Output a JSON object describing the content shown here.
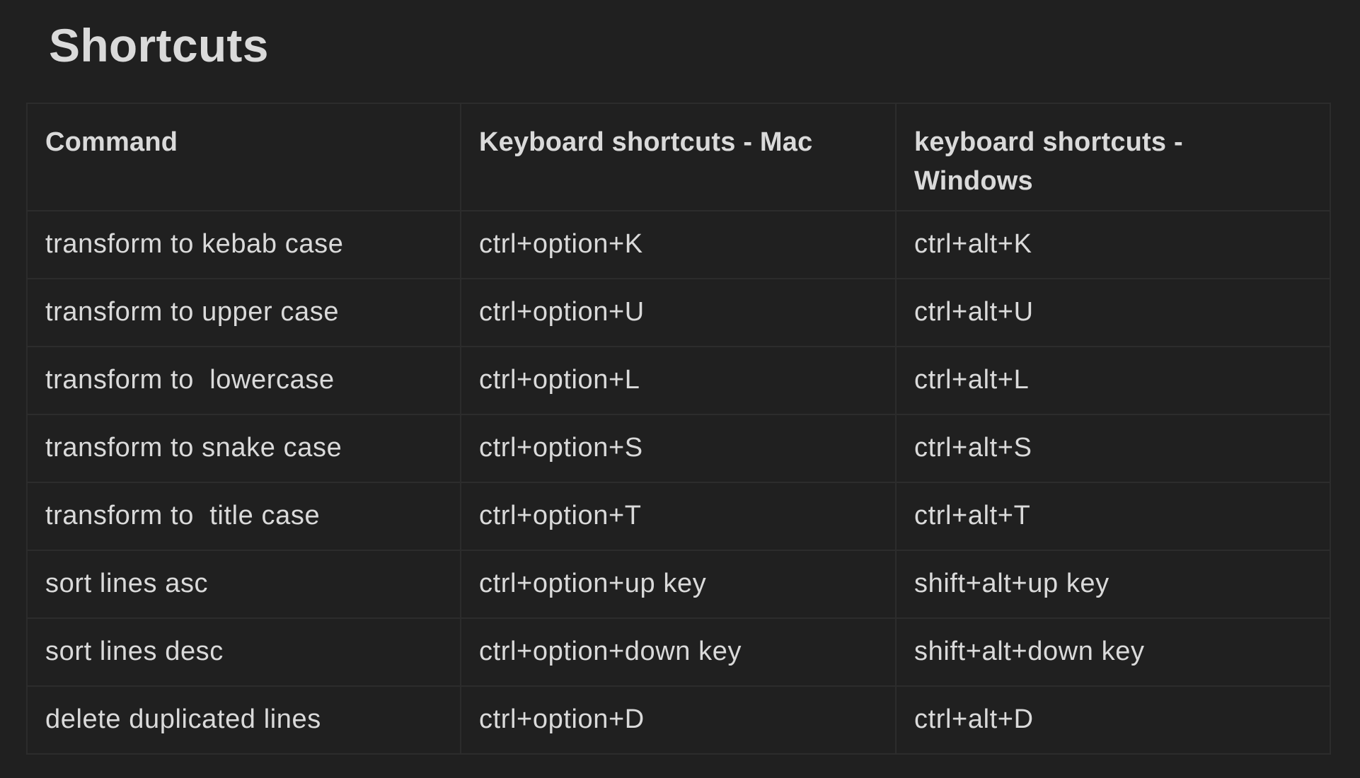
{
  "page": {
    "title": "Shortcuts"
  },
  "table": {
    "headers": [
      "Command",
      "Keyboard shortcuts - Mac",
      "keyboard shortcuts - Windows"
    ],
    "rows": [
      {
        "command": "transform to kebab case",
        "mac": "ctrl+option+K",
        "windows": "ctrl+alt+K"
      },
      {
        "command": "transform to upper case",
        "mac": "ctrl+option+U",
        "windows": "ctrl+alt+U"
      },
      {
        "command": "transform to  lowercase",
        "mac": "ctrl+option+L",
        "windows": "ctrl+alt+L"
      },
      {
        "command": "transform to snake case",
        "mac": "ctrl+option+S",
        "windows": "ctrl+alt+S"
      },
      {
        "command": "transform to  title case",
        "mac": "ctrl+option+T",
        "windows": "ctrl+alt+T"
      },
      {
        "command": "sort lines asc",
        "mac": "ctrl+option+up key",
        "windows": "shift+alt+up key"
      },
      {
        "command": "sort lines desc",
        "mac": "ctrl+option+down key",
        "windows": "shift+alt+down key"
      },
      {
        "command": "delete duplicated lines",
        "mac": "ctrl+option+D",
        "windows": "ctrl+alt+D"
      }
    ]
  },
  "colors": {
    "background": "#202020",
    "text": "#dadada",
    "border": "#2c2c2c"
  }
}
